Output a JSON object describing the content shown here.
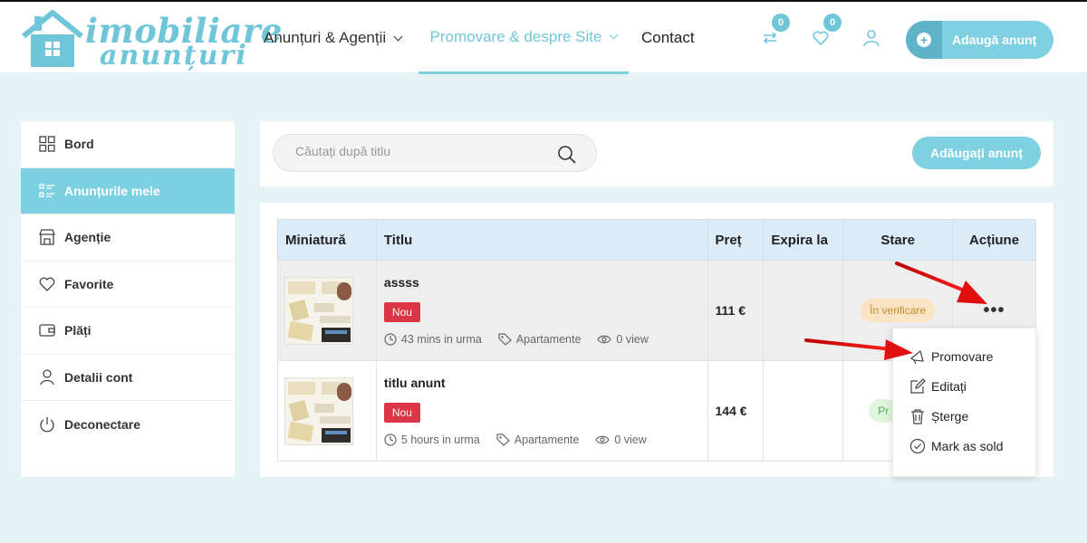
{
  "brand": {
    "line1": "imobiliare",
    "line2": "anunțuri",
    "color": "#6fc6d9"
  },
  "nav": {
    "listings": "Anunțuri & Agenții",
    "promote": "Promovare & despre Site",
    "contact": "Contact"
  },
  "header": {
    "compare_count": "0",
    "favorites_count": "0",
    "add_label": "Adaugă anunț"
  },
  "sidebar": {
    "items": [
      {
        "label": "Bord",
        "icon": "grid-icon"
      },
      {
        "label": "Anunțurile mele",
        "icon": "list-icon",
        "active": true
      },
      {
        "label": "Agenție",
        "icon": "store-icon"
      },
      {
        "label": "Favorite",
        "icon": "heart-icon"
      },
      {
        "label": "Plăți",
        "icon": "wallet-icon"
      },
      {
        "label": "Detalii cont",
        "icon": "user-icon"
      },
      {
        "label": "Deconectare",
        "icon": "power-icon"
      }
    ]
  },
  "search": {
    "placeholder": "Căutați după titlu",
    "add_label": "Adăugați anunț"
  },
  "table": {
    "headers": [
      "Miniatură",
      "Titlu",
      "Preț",
      "Expira la",
      "Stare",
      "Acțiune"
    ],
    "rows": [
      {
        "title": "assss",
        "badge": "Nou",
        "time": "43 mins in urma",
        "category": "Apartamente",
        "views": "0 view",
        "price": "111 €",
        "expires": "",
        "status": "În verificare"
      },
      {
        "title": "titlu anunt",
        "badge": "Nou",
        "time": "5 hours in urma",
        "category": "Apartamente",
        "views": "0 view",
        "price": "144 €",
        "expires": "",
        "status": "Pr"
      }
    ]
  },
  "actions_menu": {
    "trigger": "•••",
    "items": [
      "Promovare",
      "Editați",
      "Șterge",
      "Mark as sold"
    ]
  },
  "colors": {
    "accent": "#7dd0e0",
    "danger": "#dc3545",
    "annotation": "#e01010"
  }
}
